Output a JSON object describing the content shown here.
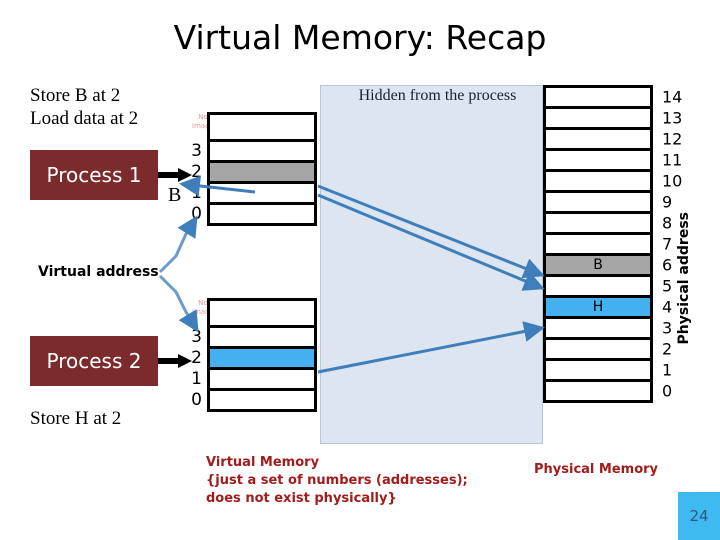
{
  "slide": {
    "title": "Virtual Memory: Recap",
    "page_number": "24"
  },
  "colors": {
    "process_box": "#7b2b2b",
    "hidden_panel": "#dde5f0",
    "gray_cell": "#a6a6a6",
    "blue_cell": "#44b0f0",
    "caption_red": "#a21c1c",
    "badge": "#3fbaf0",
    "arrow": "#3d7ebb"
  },
  "instructions": {
    "store_b": "Store B at 2",
    "load_data": "Load data at 2",
    "store_h": "Store H at 2"
  },
  "processes": [
    {
      "label": "Process 1"
    },
    {
      "label": "Process 2"
    }
  ],
  "labels": {
    "virtual_address": "Virtual address",
    "physical_address": "Physical address",
    "hidden_from_process": "Hidden from the process",
    "b_annotation": "B",
    "no_image": "No\nImage"
  },
  "virtual_memory": {
    "group_1": {
      "cells": [
        {
          "index": "",
          "value": "",
          "fill": "white",
          "partial": true
        },
        {
          "index": "3",
          "value": "",
          "fill": "white",
          "partial": false
        },
        {
          "index": "2",
          "value": "",
          "fill": "gray",
          "partial": false
        },
        {
          "index": "1",
          "value": "",
          "fill": "white",
          "partial": false
        },
        {
          "index": "0",
          "value": "",
          "fill": "white",
          "partial": false
        }
      ]
    },
    "group_2": {
      "cells": [
        {
          "index": "",
          "value": "",
          "fill": "white",
          "partial": true
        },
        {
          "index": "3",
          "value": "",
          "fill": "white",
          "partial": false
        },
        {
          "index": "2",
          "value": "",
          "fill": "blue",
          "partial": false
        },
        {
          "index": "1",
          "value": "",
          "fill": "white",
          "partial": false
        },
        {
          "index": "0",
          "value": "",
          "fill": "white",
          "partial": false
        }
      ]
    }
  },
  "physical_memory": {
    "cells": [
      {
        "index": "14",
        "value": "",
        "fill": "white"
      },
      {
        "index": "13",
        "value": "",
        "fill": "white"
      },
      {
        "index": "12",
        "value": "",
        "fill": "white"
      },
      {
        "index": "11",
        "value": "",
        "fill": "white"
      },
      {
        "index": "10",
        "value": "",
        "fill": "white"
      },
      {
        "index": "9",
        "value": "",
        "fill": "white"
      },
      {
        "index": "8",
        "value": "",
        "fill": "white"
      },
      {
        "index": "7",
        "value": "",
        "fill": "white"
      },
      {
        "index": "6",
        "value": "B",
        "fill": "gray"
      },
      {
        "index": "5",
        "value": "",
        "fill": "white"
      },
      {
        "index": "4",
        "value": "H",
        "fill": "blue"
      },
      {
        "index": "3",
        "value": "",
        "fill": "white"
      },
      {
        "index": "2",
        "value": "",
        "fill": "white"
      },
      {
        "index": "1",
        "value": "",
        "fill": "white"
      },
      {
        "index": "0",
        "value": "",
        "fill": "white"
      }
    ]
  },
  "captions": {
    "virtual_memory": "Virtual Memory\n{just a set of numbers (addresses);\ndoes not exist physically}",
    "physical_memory": "Physical Memory"
  }
}
